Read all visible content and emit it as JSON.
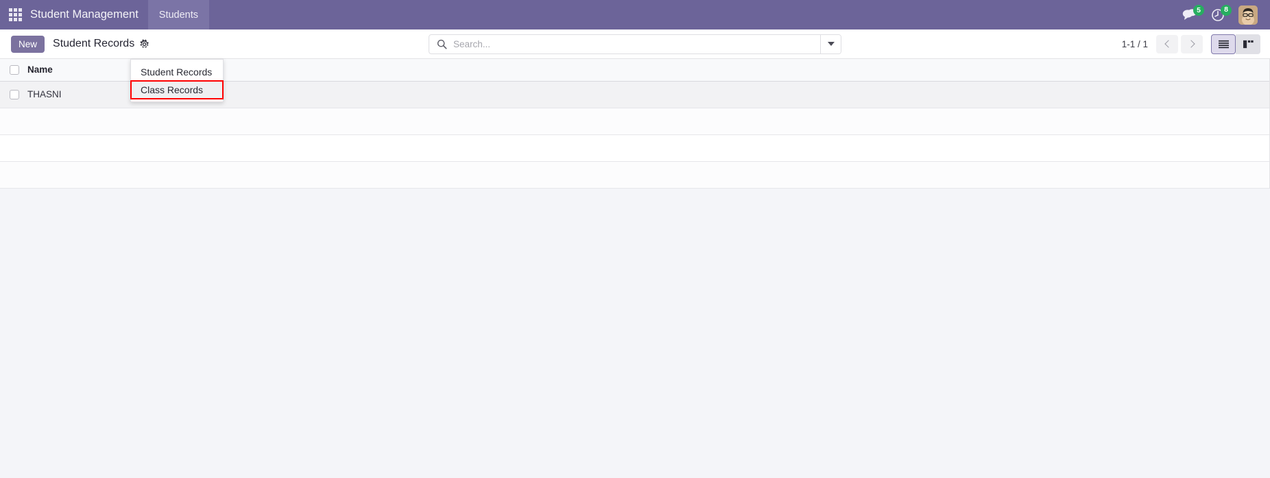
{
  "navbar": {
    "apps_icon": "apps-grid-icon",
    "brand": "Student Management",
    "menus": [
      {
        "label": "Students",
        "active": true
      }
    ],
    "messages": {
      "icon": "chat-bubble-icon",
      "badge": "5"
    },
    "activities": {
      "icon": "clock-activity-icon",
      "badge": "8"
    },
    "avatar": {
      "icon": "user-avatar",
      "alt": "User avatar"
    },
    "bg_color": "#6C6499",
    "active_menu_bg": "#7B74A6",
    "badge_color": "#27AE60"
  },
  "control_panel": {
    "new_label": "New",
    "breadcrumb": "Student Records",
    "gear_icon": "gear-icon",
    "search": {
      "icon": "search-icon",
      "value": "",
      "placeholder": "Search...",
      "toggle_icon": "chevron-down-icon"
    },
    "pager": {
      "range": "1-1 / 1",
      "prev_icon": "chevron-left-icon",
      "next_icon": "chevron-right-icon"
    },
    "views": [
      {
        "name": "list",
        "icon": "list-view-icon",
        "active": true
      },
      {
        "name": "kanban",
        "icon": "kanban-view-icon",
        "active": false
      }
    ],
    "new_button_color": "#7B729F",
    "active_view_border": "#8079AB"
  },
  "dropdown": {
    "open": true,
    "items": [
      {
        "label": "Student Records",
        "highlighted": false
      },
      {
        "label": "Class Records",
        "highlighted": true
      }
    ],
    "highlight_color": "#FF0000"
  },
  "list_view": {
    "columns": [
      "Name"
    ],
    "rows": [
      {
        "name": "THASNI"
      }
    ],
    "empty_rows": 2
  }
}
